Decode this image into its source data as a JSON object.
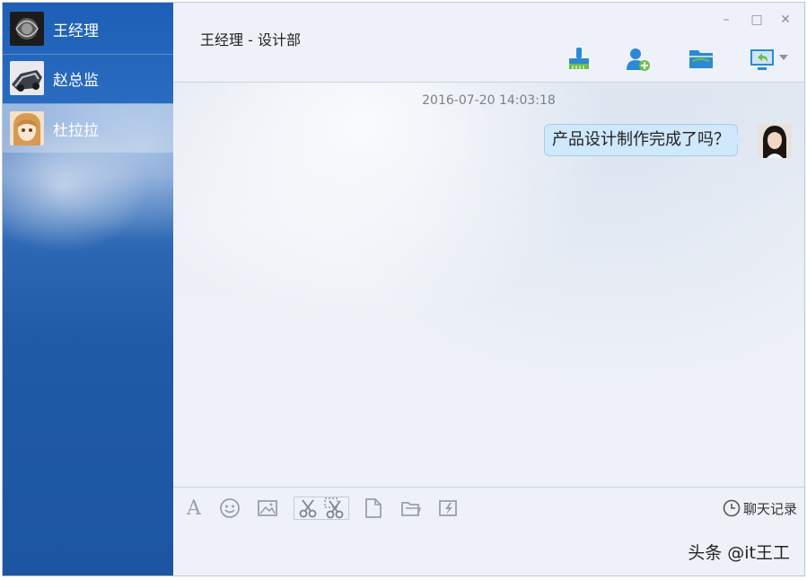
{
  "sidebar": {
    "contacts": [
      {
        "name": "王经理",
        "avatar": "dark-flower-avatar",
        "active": false
      },
      {
        "name": "赵总监",
        "avatar": "car-avatar",
        "active": false
      },
      {
        "name": "杜拉拉",
        "avatar": "anime-girl-avatar",
        "active": true
      }
    ]
  },
  "header": {
    "title": "王经理 - 设计部",
    "window_controls": {
      "minimize": "–",
      "maximize": "□",
      "close": "✕"
    },
    "tools": [
      "brush-icon",
      "add-contact-icon",
      "folder-icon",
      "screen-share-icon"
    ]
  },
  "chat": {
    "timestamp": "2016-07-20 14:03:18",
    "messages": [
      {
        "text": "产品设计制作完成了吗？",
        "avatar": "woman-avatar"
      }
    ]
  },
  "input_toolbar": {
    "font_label": "A",
    "history_label": "聊天记录",
    "icons": [
      "font-icon",
      "emoji-icon",
      "image-icon",
      "scissors-icon",
      "screenshot-icon",
      "file-icon",
      "folder-send-icon",
      "shake-icon",
      "clock-icon"
    ]
  },
  "watermark": "头条 @it王工",
  "colors": {
    "sidebar_blue": "#1d5fb6",
    "bubble": "#cfe8fb",
    "tool_blue": "#2a8ad4",
    "tool_green": "#6cc04a"
  }
}
